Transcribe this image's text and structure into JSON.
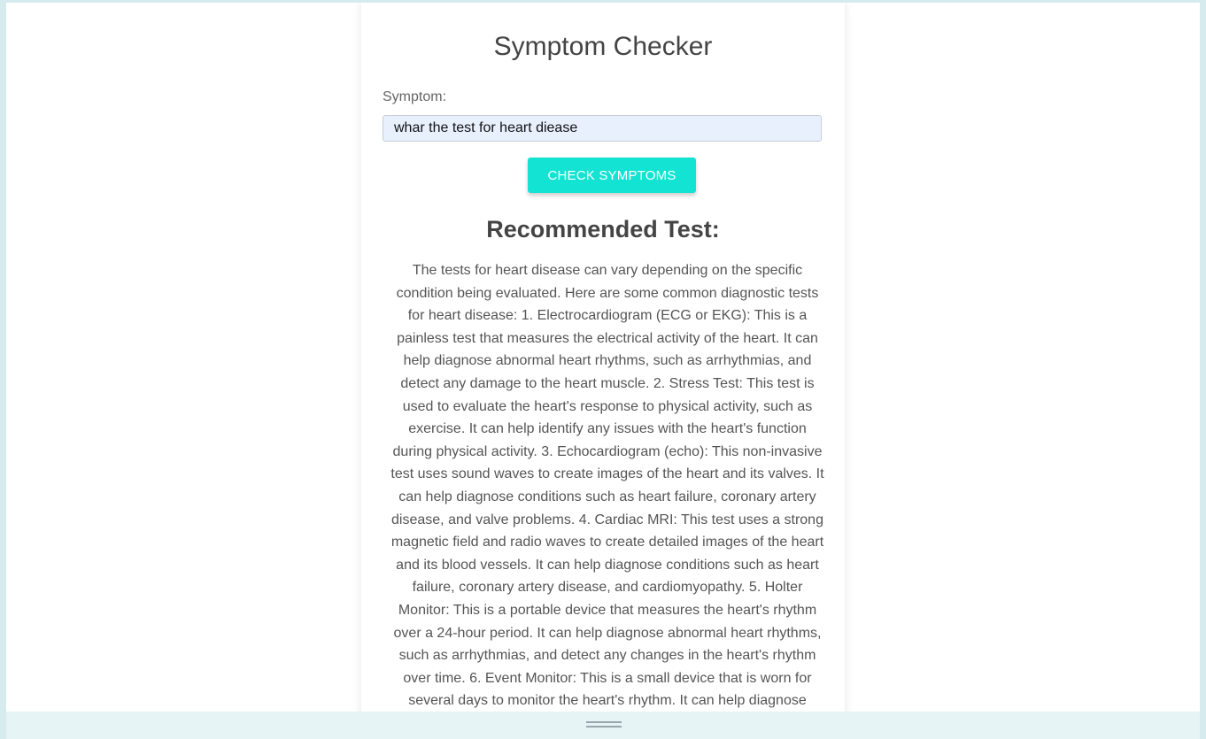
{
  "app": {
    "title": "Symptom Checker"
  },
  "form": {
    "symptom_label": "Symptom:",
    "symptom_value": "whar the test for heart diease",
    "submit_label": "CHECK SYMPTOMS"
  },
  "result": {
    "heading": "Recommended Test:",
    "text": "The tests for heart disease can vary depending on the specific condition being evaluated. Here are some common diagnostic tests for heart disease: 1. Electrocardiogram (ECG or EKG): This is a painless test that measures the electrical activity of the heart. It can help diagnose abnormal heart rhythms, such as arrhythmias, and detect any damage to the heart muscle. 2. Stress Test: This test is used to evaluate the heart's response to physical activity, such as exercise. It can help identify any issues with the heart's function during physical activity. 3. Echocardiogram (echo): This non-invasive test uses sound waves to create images of the heart and its valves. It can help diagnose conditions such as heart failure, coronary artery disease, and valve problems. 4. Cardiac MRI: This test uses a strong magnetic field and radio waves to create detailed images of the heart and its blood vessels. It can help diagnose conditions such as heart failure, coronary artery disease, and cardiomyopathy. 5. Holter Monitor: This is a portable device that measures the heart's rhythm over a 24-hour period. It can help diagnose abnormal heart rhythms, such as arrhythmias, and detect any changes in the heart's rhythm over time. 6. Event Monitor: This is a small device that is worn for several days to monitor the heart's rhythm. It can help diagnose"
  },
  "colors": {
    "accent": "#13e3d2",
    "input_bg": "#e8f0fe",
    "text": "#444444"
  },
  "icons": {
    "resize_handle": "drag-handle-icon"
  }
}
